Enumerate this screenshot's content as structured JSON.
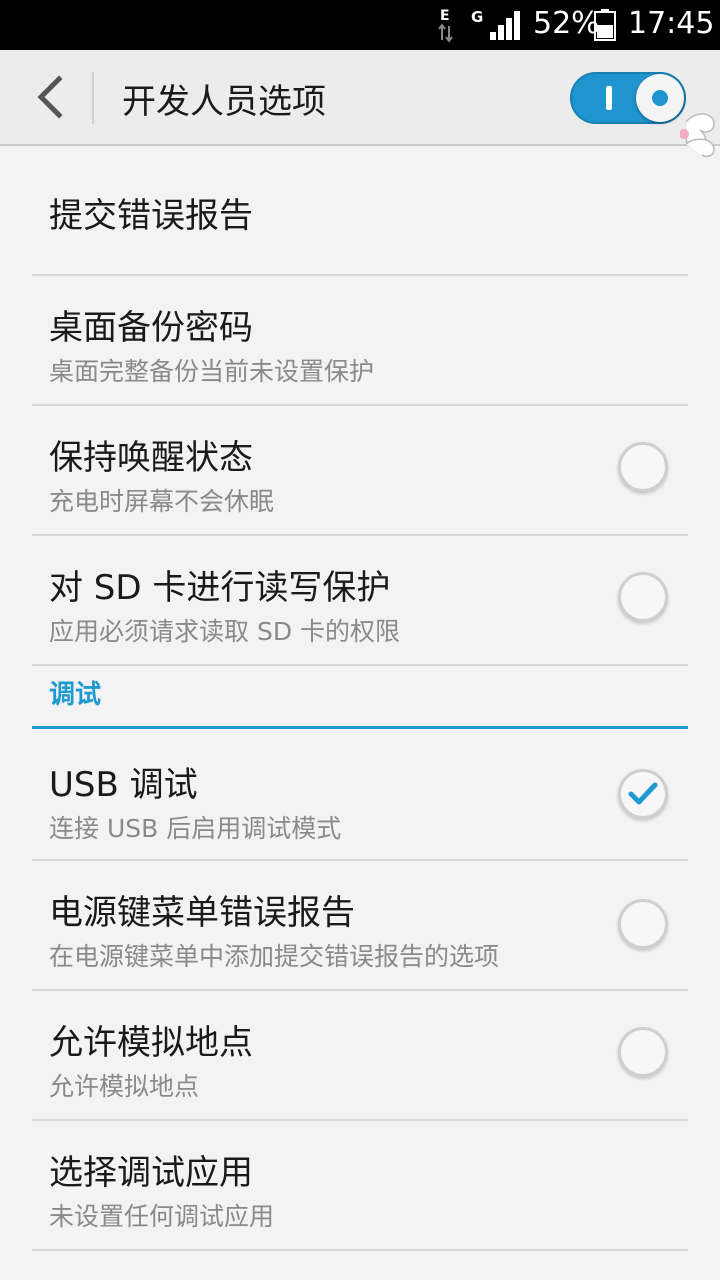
{
  "status_bar": {
    "network_type": "G",
    "battery_percent": "52%",
    "time": "17:45"
  },
  "header": {
    "title": "开发人员选项",
    "master_switch_on": true
  },
  "items": [
    {
      "title": "提交错误报告",
      "subtitle": ""
    },
    {
      "title": "桌面备份密码",
      "subtitle": "桌面完整备份当前未设置保护"
    },
    {
      "title": "保持唤醒状态",
      "subtitle": "充电时屏幕不会休眠",
      "checked": false
    },
    {
      "title": "对 SD 卡进行读写保护",
      "subtitle": "应用必须请求读取 SD 卡的权限",
      "checked": false
    }
  ],
  "section": {
    "title": "调试"
  },
  "debug_items": [
    {
      "title": "USB 调试",
      "subtitle": "连接 USB 后启用调试模式",
      "checked": true
    },
    {
      "title": "电源键菜单错误报告",
      "subtitle": "在电源键菜单中添加提交错误报告的选项",
      "checked": false
    },
    {
      "title": "允许模拟地点",
      "subtitle": "允许模拟地点",
      "checked": false
    },
    {
      "title": "选择调试应用",
      "subtitle": "未设置任何调试应用"
    }
  ],
  "colors": {
    "accent": "#1e9ad0",
    "toggle": "#1f95cf"
  }
}
